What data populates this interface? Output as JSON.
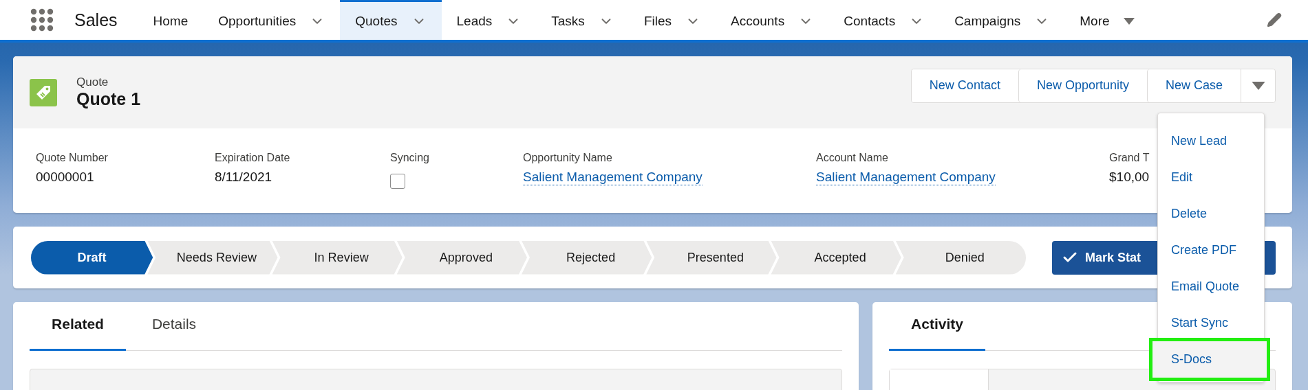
{
  "nav": {
    "app_name": "Sales",
    "items": [
      {
        "label": "Home",
        "selected": false,
        "kind": "plain"
      },
      {
        "label": "Opportunities",
        "selected": false,
        "kind": "menu"
      },
      {
        "label": "Quotes",
        "selected": true,
        "kind": "menu"
      },
      {
        "label": "Leads",
        "selected": false,
        "kind": "menu"
      },
      {
        "label": "Tasks",
        "selected": false,
        "kind": "menu"
      },
      {
        "label": "Files",
        "selected": false,
        "kind": "menu"
      },
      {
        "label": "Accounts",
        "selected": false,
        "kind": "menu"
      },
      {
        "label": "Contacts",
        "selected": false,
        "kind": "menu"
      },
      {
        "label": "Campaigns",
        "selected": false,
        "kind": "menu"
      },
      {
        "label": "More",
        "selected": false,
        "kind": "more"
      }
    ]
  },
  "header": {
    "object_type": "Quote",
    "title": "Quote 1",
    "actions": [
      "New Contact",
      "New Opportunity",
      "New Case"
    ],
    "fields": [
      {
        "label": "Quote Number",
        "kind": "text",
        "value": "00000001"
      },
      {
        "label": "Expiration Date",
        "kind": "text",
        "value": "8/11/2021"
      },
      {
        "label": "Syncing",
        "kind": "checkbox",
        "checked": false
      },
      {
        "label": "Opportunity Name",
        "kind": "link",
        "value": "Salient Management Company"
      },
      {
        "label": "Account Name",
        "kind": "link",
        "value": "Salient Management Company"
      },
      {
        "label": "Grand T",
        "kind": "text",
        "value": "$10,00"
      }
    ]
  },
  "path": {
    "stages": [
      {
        "label": "Draft",
        "selected": true
      },
      {
        "label": "Needs Review",
        "selected": false
      },
      {
        "label": "In Review",
        "selected": false
      },
      {
        "label": "Approved",
        "selected": false
      },
      {
        "label": "Rejected",
        "selected": false
      },
      {
        "label": "Presented",
        "selected": false
      },
      {
        "label": "Accepted",
        "selected": false
      },
      {
        "label": "Denied",
        "selected": false
      }
    ],
    "button": "Mark Stat"
  },
  "left_tabs": [
    {
      "label": "Related",
      "selected": true
    },
    {
      "label": "Details",
      "selected": false
    }
  ],
  "right_tabs": [
    {
      "label": "Activity",
      "selected": true
    }
  ],
  "action_menu": {
    "items": [
      {
        "label": "New Lead",
        "selected": false
      },
      {
        "label": "Edit",
        "selected": false
      },
      {
        "label": "Delete",
        "selected": false
      },
      {
        "label": "Create PDF",
        "selected": false
      },
      {
        "label": "Email Quote",
        "selected": false
      },
      {
        "label": "Start Sync",
        "selected": false
      },
      {
        "label": "S-Docs",
        "selected": true
      }
    ]
  }
}
